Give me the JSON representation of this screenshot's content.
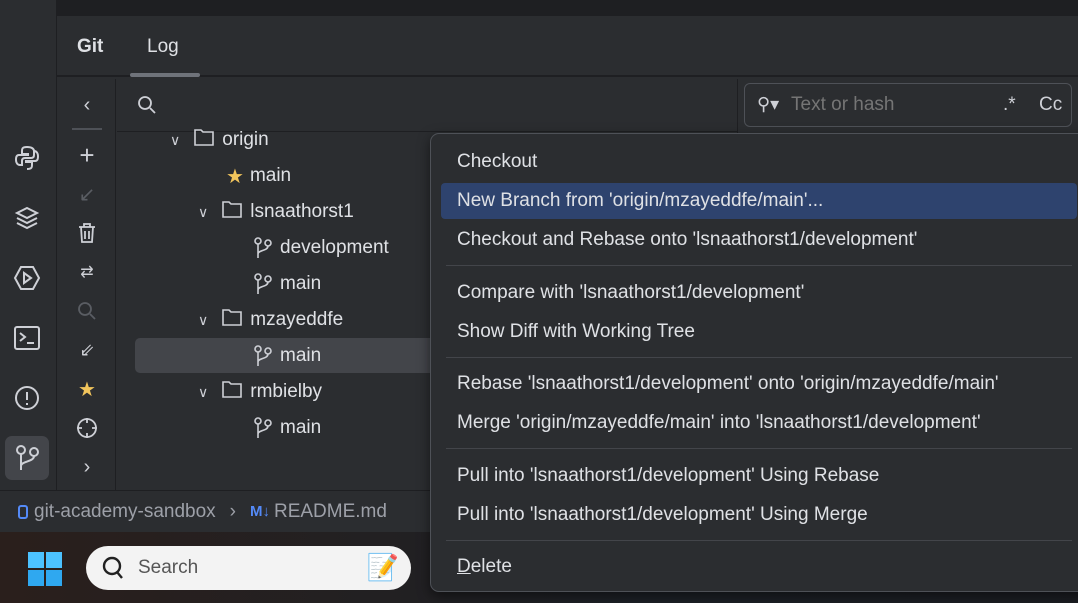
{
  "header": {
    "tabs": [
      {
        "label": "Git"
      },
      {
        "label": "Log"
      }
    ]
  },
  "log_search": {
    "placeholder": "Text or hash",
    "regex_label": ".*",
    "case_label": "Cc"
  },
  "tree": [
    {
      "label": "origin",
      "type": "folder",
      "expanded": true
    },
    {
      "label": "main",
      "type": "favorite-branch"
    },
    {
      "label": "lsnaathorst1",
      "type": "folder",
      "expanded": true
    },
    {
      "label": "development",
      "type": "branch"
    },
    {
      "label": "main",
      "type": "branch"
    },
    {
      "label": "mzayeddfe",
      "type": "folder",
      "expanded": true
    },
    {
      "label": "main",
      "type": "branch",
      "selected": true
    },
    {
      "label": "rmbielby",
      "type": "folder",
      "expanded": true
    },
    {
      "label": "main",
      "type": "branch"
    }
  ],
  "menu": {
    "items": [
      {
        "label": "Checkout"
      },
      {
        "label": "New Branch from 'origin/mzayeddfe/main'...",
        "highlighted": true
      },
      {
        "label": "Checkout and Rebase onto 'lsnaathorst1/development'"
      },
      {
        "label": "Compare with 'lsnaathorst1/development'"
      },
      {
        "label": "Show Diff with Working Tree"
      },
      {
        "label": "Rebase 'lsnaathorst1/development' onto 'origin/mzayeddfe/main'"
      },
      {
        "label": "Merge 'origin/mzayeddfe/main' into 'lsnaathorst1/development'"
      },
      {
        "label": "Pull into 'lsnaathorst1/development' Using Rebase"
      },
      {
        "label": "Pull into 'lsnaathorst1/development' Using Merge"
      },
      {
        "label": "Delete"
      }
    ]
  },
  "status": {
    "project": "git-academy-sandbox",
    "file": "README.md",
    "file_icon": "M↓"
  },
  "taskbar": {
    "search_label": "Search"
  },
  "colors": {
    "highlight": "#2e436e",
    "star": "#f2c55c",
    "accent": "#548af7"
  }
}
